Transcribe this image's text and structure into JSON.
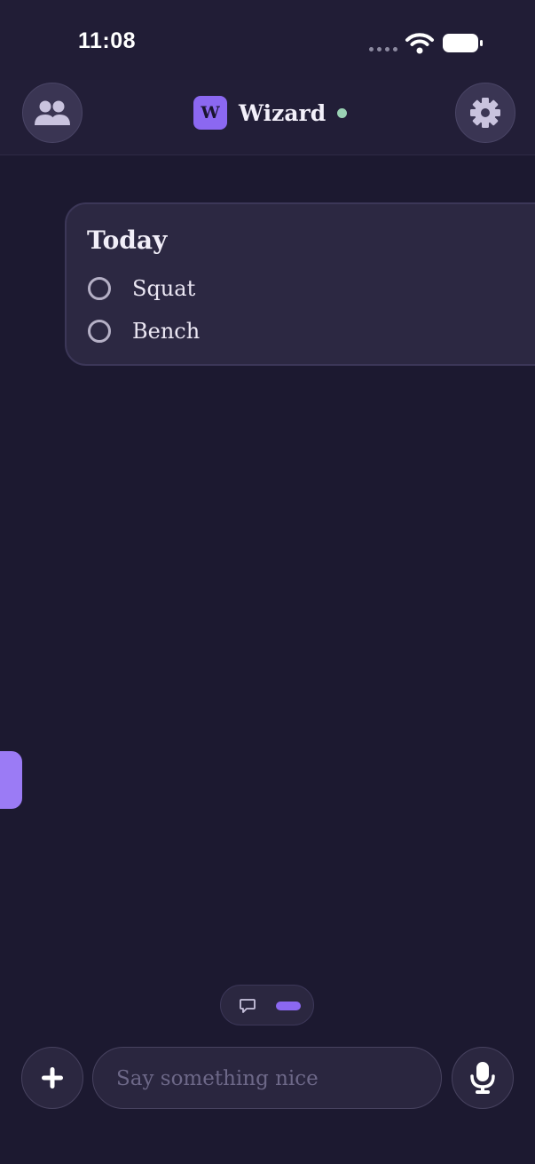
{
  "status_bar": {
    "time": "11:08",
    "icons": [
      "signal-dots-icon",
      "wifi-icon",
      "battery-icon"
    ]
  },
  "header": {
    "left_button_icon": "people-icon",
    "brand_initial": "W",
    "brand_name": "Wizard",
    "online_status_color": "#9ad2b4",
    "right_button_icon": "gear-icon"
  },
  "card": {
    "title": "Today",
    "tasks": [
      {
        "label": "Squat",
        "checked": false
      },
      {
        "label": "Bench",
        "checked": false
      }
    ]
  },
  "mode_toggle": {
    "options": [
      "chat-bubble-icon",
      "voice-pill-icon"
    ],
    "selected": "voice-pill-icon"
  },
  "composer": {
    "add_icon": "plus-icon",
    "placeholder": "Say something nice",
    "value": "",
    "mic_icon": "microphone-icon"
  },
  "colors": {
    "background": "#1c1930",
    "accent": "#8b68f1",
    "side_tab": "#9b7bf5",
    "online": "#9ad2b4"
  }
}
